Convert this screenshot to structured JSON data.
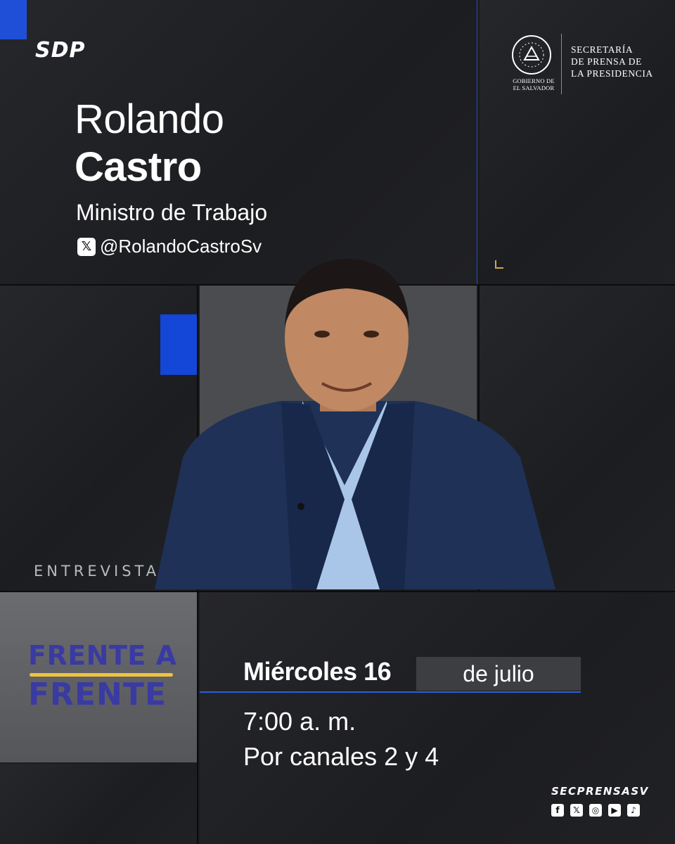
{
  "brand": {
    "logo": "SDP",
    "handle": "SECPRENSASV"
  },
  "gov": {
    "small_line1": "GOBIERNO DE",
    "small_line2": "EL SALVADOR",
    "title_line1": "SECRETARÍA",
    "title_line2": "DE PRENSA DE",
    "title_line3": "LA PRESIDENCIA"
  },
  "guest": {
    "first_name": "Rolando",
    "last_name": "Castro",
    "role": "Ministro de Trabajo",
    "x_handle": "@RolandoCastroSv"
  },
  "program": {
    "label": "ENTREVISTA",
    "name_line1": "FRENTE A",
    "name_line2": "FRENTE"
  },
  "schedule": {
    "day": "Miércoles 16",
    "month": "de julio",
    "time": "7:00 a. m.",
    "channels": "Por canales 2 y 4"
  },
  "social": {
    "icons": [
      "facebook-icon",
      "x-icon",
      "instagram-icon",
      "youtube-icon",
      "tiktok-icon"
    ]
  },
  "colors": {
    "accent_blue": "#1446d8",
    "program_text": "#3a3aa3",
    "program_line": "#f2c23a",
    "background": "#1b1c1f"
  }
}
